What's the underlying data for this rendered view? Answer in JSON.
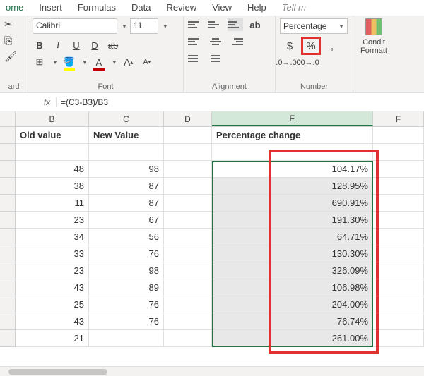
{
  "tabs": {
    "home": "ome",
    "insert": "Insert",
    "formulas": "Formulas",
    "data": "Data",
    "review": "Review",
    "view": "View",
    "help": "Help",
    "tell": "Tell m"
  },
  "clipboard_label": "ard",
  "font": {
    "name": "Calibri",
    "size": "11",
    "label": "Font"
  },
  "alignment_label": "Alignment",
  "number": {
    "format": "Percentage",
    "label": "Number"
  },
  "cond_format": {
    "line1": "Condit",
    "line2": "Formatt"
  },
  "formula_bar": {
    "name_box": "",
    "fx": "fx",
    "formula": "=(C3-B3)/B3"
  },
  "columns": {
    "b": "B",
    "c": "C",
    "d": "D",
    "e": "E",
    "f": "F"
  },
  "headers": {
    "old": "Old value",
    "new": "New Value",
    "pct": "Percentage change"
  },
  "rows": [
    {
      "old": "48",
      "new": "98",
      "pct": "104.17%"
    },
    {
      "old": "38",
      "new": "87",
      "pct": "128.95%"
    },
    {
      "old": "11",
      "new": "87",
      "pct": "690.91%"
    },
    {
      "old": "23",
      "new": "67",
      "pct": "191.30%"
    },
    {
      "old": "34",
      "new": "56",
      "pct": "64.71%"
    },
    {
      "old": "33",
      "new": "76",
      "pct": "130.30%"
    },
    {
      "old": "23",
      "new": "98",
      "pct": "326.09%"
    },
    {
      "old": "43",
      "new": "89",
      "pct": "106.98%"
    },
    {
      "old": "25",
      "new": "76",
      "pct": "204.00%"
    },
    {
      "old": "43",
      "new": "76",
      "pct": "76.74%"
    },
    {
      "old": "21",
      "new": "",
      "pct": "261.00%"
    }
  ]
}
